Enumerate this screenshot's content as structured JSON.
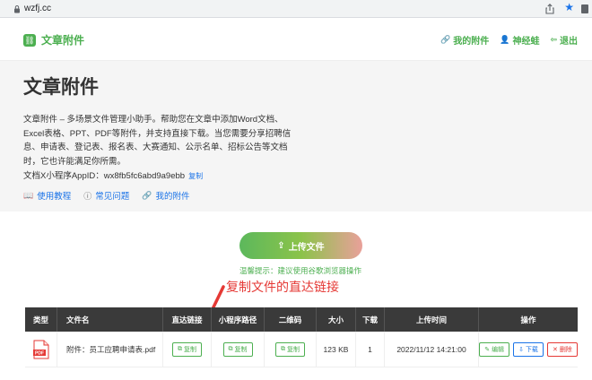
{
  "browser": {
    "url": "wzfj.cc"
  },
  "header": {
    "logo_text": "文章附件",
    "nav": [
      {
        "label": "我的附件"
      },
      {
        "label": "神经蛙"
      },
      {
        "label": "退出"
      }
    ]
  },
  "hero": {
    "title": "文章附件",
    "description": "文章附件 – 多场景文件管理小助手。帮助您在文章中添加Word文档、Excel表格、PPT、PDF等附件，并支持直接下载。当您需要分享招聘信息、申请表、登记表、报名表、大赛通知、公示名单、招标公告等文档时，它也许能满足你所需。",
    "appid_label": "文档X小程序AppID：wx8fb5fc6abd9a9ebb",
    "copy_label": "复制",
    "links": [
      {
        "label": "使用教程"
      },
      {
        "label": "常见问题"
      },
      {
        "label": "我的附件"
      }
    ]
  },
  "upload": {
    "label": "上传文件",
    "tip": "温馨提示：建议使用谷歌浏览器操作"
  },
  "annotation": "复制文件的直达链接",
  "table": {
    "headers": [
      "类型",
      "文件名",
      "直达链接",
      "小程序路径",
      "二维码",
      "大小",
      "下载",
      "上传时间",
      "操作"
    ],
    "rows": [
      {
        "type_label": "PDF",
        "filename": "附件：员工应聘申请表.pdf",
        "direct_link_btn": "复制",
        "mini_path_btn": "复制",
        "qrcode_btn": "复制",
        "size": "123 KB",
        "downloads": "1",
        "uploaded": "2022/11/12 14:21:00",
        "edit": "编辑",
        "download": "下载",
        "delete": "删除"
      }
    ]
  },
  "colors": {
    "accent": "#4caf50",
    "link": "#1a73e8",
    "danger": "#e53935",
    "header_bg": "#3a3a3a"
  }
}
